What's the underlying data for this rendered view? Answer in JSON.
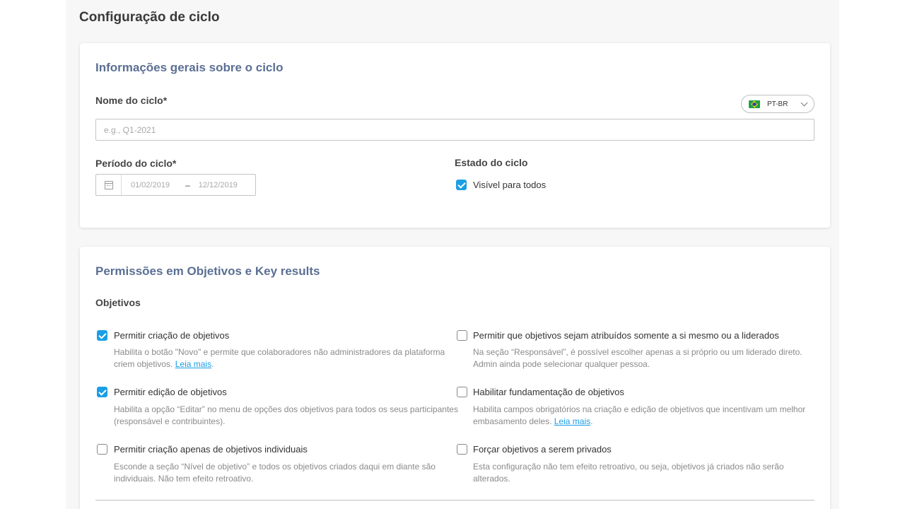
{
  "page": {
    "title": "Configuração de ciclo"
  },
  "general": {
    "section_title": "Informações gerais sobre o ciclo",
    "name_label": "Nome do ciclo",
    "required_mark": "*",
    "name_placeholder": "e.g., Q1-2021",
    "name_value": "",
    "language": {
      "flag": "brazil-flag",
      "code": "PT-BR"
    },
    "period_label": "Período do ciclo",
    "period_start": "01/02/2019",
    "period_separator": "–",
    "period_end": "12/12/2019",
    "state_label": "Estado do ciclo",
    "visible_label": "Visível para todos",
    "visible_checked": true
  },
  "permissions": {
    "section_title": "Permissões em Objetivos e Key results",
    "subsection": "Objetivos",
    "options": [
      {
        "label": "Permitir criação de objetivos",
        "checked": true,
        "desc": "Habilita o botão \"Novo\" e permite que colaboradores não administradores da plataforma criem objetivos.",
        "link": "Leia mais",
        "suffix": "."
      },
      {
        "label": "Permitir que objetivos sejam atribuídos somente a si mesmo ou a liderados",
        "checked": false,
        "desc": "Na seção “Responsável”, é possível escolher apenas a si próprio ou um liderado direto. Admin ainda pode selecionar qualquer pessoa."
      },
      {
        "label": "Permitir edição de objetivos",
        "checked": true,
        "desc": "Habilita a opção “Editar” no menu de opções dos objetivos para todos os seus participantes (responsável e contribuintes)."
      },
      {
        "label": "Habilitar fundamentação de objetivos",
        "checked": false,
        "desc": "Habilita campos obrigatórios na criação e edição de objetivos que incentivam um melhor embasamento deles.",
        "link": "Leia mais",
        "suffix": "."
      },
      {
        "label": "Permitir criação apenas de objetivos individuais",
        "checked": false,
        "desc": "Esconde a seção “Nível de objetivo” e todos os objetivos criados daqui em diante são individuais. Não tem efeito retroativo."
      },
      {
        "label": "Forçar objetivos a serem privados",
        "checked": false,
        "desc": "Esta configuração não tem efeito retroativo, ou seja, objetivos já criados não serão alterados."
      }
    ]
  },
  "colors": {
    "accent": "#1a9ee6",
    "section_title": "#5b6f94",
    "background": "#f7f7f7"
  }
}
